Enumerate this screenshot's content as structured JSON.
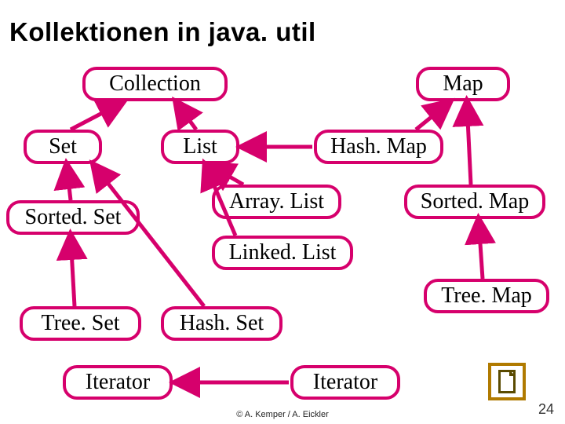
{
  "title": "Kollektionen in java. util",
  "nodes": {
    "collection": "Collection",
    "map": "Map",
    "set": "Set",
    "list": "List",
    "hashmap": "Hash. Map",
    "sortedset": "Sorted. Set",
    "arraylist": "Array. List",
    "sortedmap": "Sorted. Map",
    "linkedlist": "Linked. List",
    "treeset": "Tree. Set",
    "hashset": "Hash. Set",
    "treemap": "Tree. Map",
    "iterator1": "Iterator",
    "iterator2": "Iterator"
  },
  "footer": "© A. Kemper / A. Eickler",
  "pagenum": "24"
}
